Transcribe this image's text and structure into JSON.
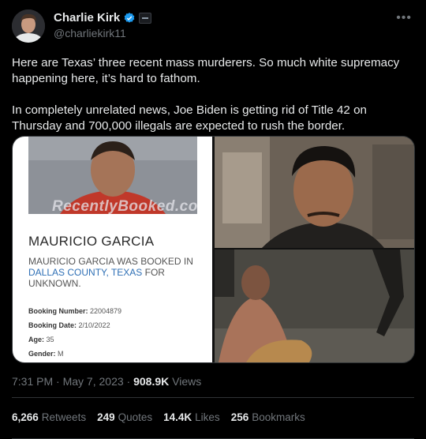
{
  "author": {
    "name": "Charlie Kirk",
    "handle": "@charliekirk11",
    "verified": true,
    "verified_color": "#1d9bf0"
  },
  "tweet": {
    "paragraphs": [
      "Here are Texas’ three recent mass murderers. So much white supremacy happening here, it’s hard to fathom.",
      "In completely unrelated news, Joe Biden is getting rid of Title 42 on Thursday and 700,000 illegals are expected to rush the border."
    ]
  },
  "media": {
    "card": {
      "watermark": "RecentlyBooked.com",
      "name": "MAURICIO GARCIA",
      "desc_prefix": "MAURICIO GARCIA WAS BOOKED IN ",
      "desc_location": "DALLAS COUNTY, TEXAS",
      "desc_suffix": " FOR UNKNOWN.",
      "fields": [
        {
          "label": "Booking Number:",
          "value": "22004879"
        },
        {
          "label": "Booking Date:",
          "value": "2/10/2022"
        },
        {
          "label": "Age:",
          "value": "35"
        },
        {
          "label": "Gender:",
          "value": "M"
        }
      ]
    }
  },
  "meta": {
    "time": "7:31 PM",
    "date": "May 7, 2023",
    "views_count": "908.9K",
    "views_label": "Views",
    "sep": "·"
  },
  "stats": {
    "retweets": {
      "count": "6,266",
      "label": "Retweets"
    },
    "quotes": {
      "count": "249",
      "label": "Quotes"
    },
    "likes": {
      "count": "14.4K",
      "label": "Likes"
    },
    "bookmarks": {
      "count": "256",
      "label": "Bookmarks"
    }
  },
  "icons": {
    "verified": "verified-badge-icon",
    "org": "org-affiliation-icon",
    "more": "more-options-icon"
  }
}
